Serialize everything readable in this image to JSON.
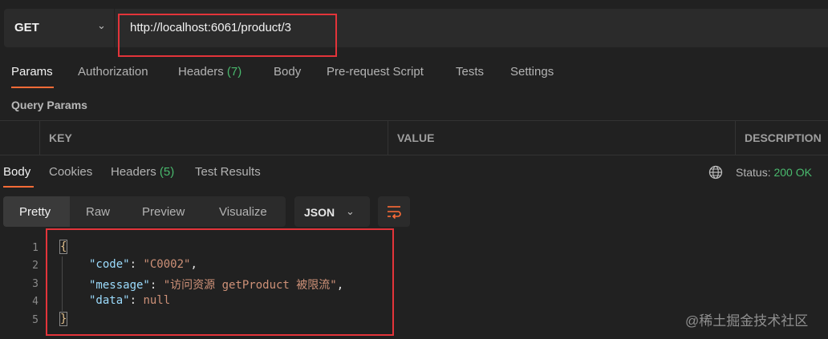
{
  "request": {
    "method": "GET",
    "url": "http://localhost:6061/product/3",
    "tabs": {
      "params": "Params",
      "authorization": "Authorization",
      "headers": "Headers",
      "headers_count": "(7)",
      "body": "Body",
      "prerequest": "Pre-request Script",
      "tests": "Tests",
      "settings": "Settings"
    },
    "query_params_label": "Query Params",
    "table_headers": {
      "key": "KEY",
      "value": "VALUE",
      "description": "DESCRIPTION"
    }
  },
  "response": {
    "tabs": {
      "body": "Body",
      "cookies": "Cookies",
      "headers": "Headers",
      "headers_count": "(5)",
      "test_results": "Test Results"
    },
    "status_label": "Status:",
    "status_value": "200 OK",
    "view_modes": [
      "Pretty",
      "Raw",
      "Preview",
      "Visualize"
    ],
    "format": "JSON",
    "line_numbers": [
      "1",
      "2",
      "3",
      "4",
      "5"
    ],
    "code": {
      "open": "{",
      "close": "}",
      "k1": "\"code\"",
      "v1": "\"C0002\"",
      "k2": "\"message\"",
      "v2": "\"访问资源 getProduct 被限流\"",
      "k3": "\"data\"",
      "v3": "null"
    }
  },
  "watermark": "@稀土掘金技术社区",
  "colors": {
    "accent": "#ff6c37",
    "ok": "#49b96d",
    "highlight": "#e3343a"
  }
}
